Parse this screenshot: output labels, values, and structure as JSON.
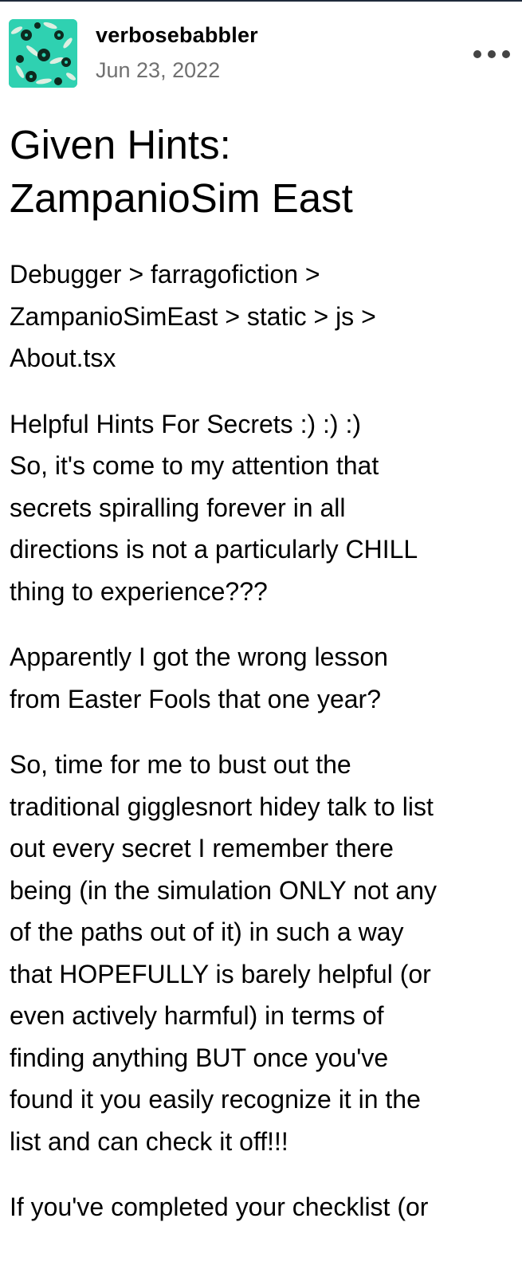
{
  "post": {
    "username": "verbosebabbler",
    "date": "Jun 23, 2022",
    "more_icon": "ellipsis-icon",
    "avatar_colors": {
      "background": "#2fd1b1",
      "flowers": "#0d2a1f",
      "leaves": "#f2f2e8"
    },
    "title_lines": [
      "Given Hints:",
      "ZampanioSim East"
    ],
    "paragraphs": [
      [
        "Debugger > farragofiction >",
        "ZampanioSimEast > static > js >",
        "About.tsx"
      ],
      [
        "Helpful Hints For Secrets :) :) :)",
        "So, it's come to my attention that",
        "secrets spiralling forever in all",
        "directions is not a particularly CHILL",
        "thing to experience???"
      ],
      [
        "Apparently I got the wrong lesson",
        "from Easter Fools that one year?"
      ],
      [
        "So, time for me to bust out the",
        "traditional gigglesnort hidey talk to list",
        "out every secret I remember there",
        "being (in the simulation ONLY not any",
        "of the paths out of it) in such a way",
        "that HOPEFULLY is barely helpful (or",
        "even actively harmful) in terms of",
        "finding anything BUT once you've",
        "found it you easily recognize it in the",
        "list and can check it off!!!"
      ],
      [
        "If you've completed your checklist (or"
      ]
    ]
  }
}
